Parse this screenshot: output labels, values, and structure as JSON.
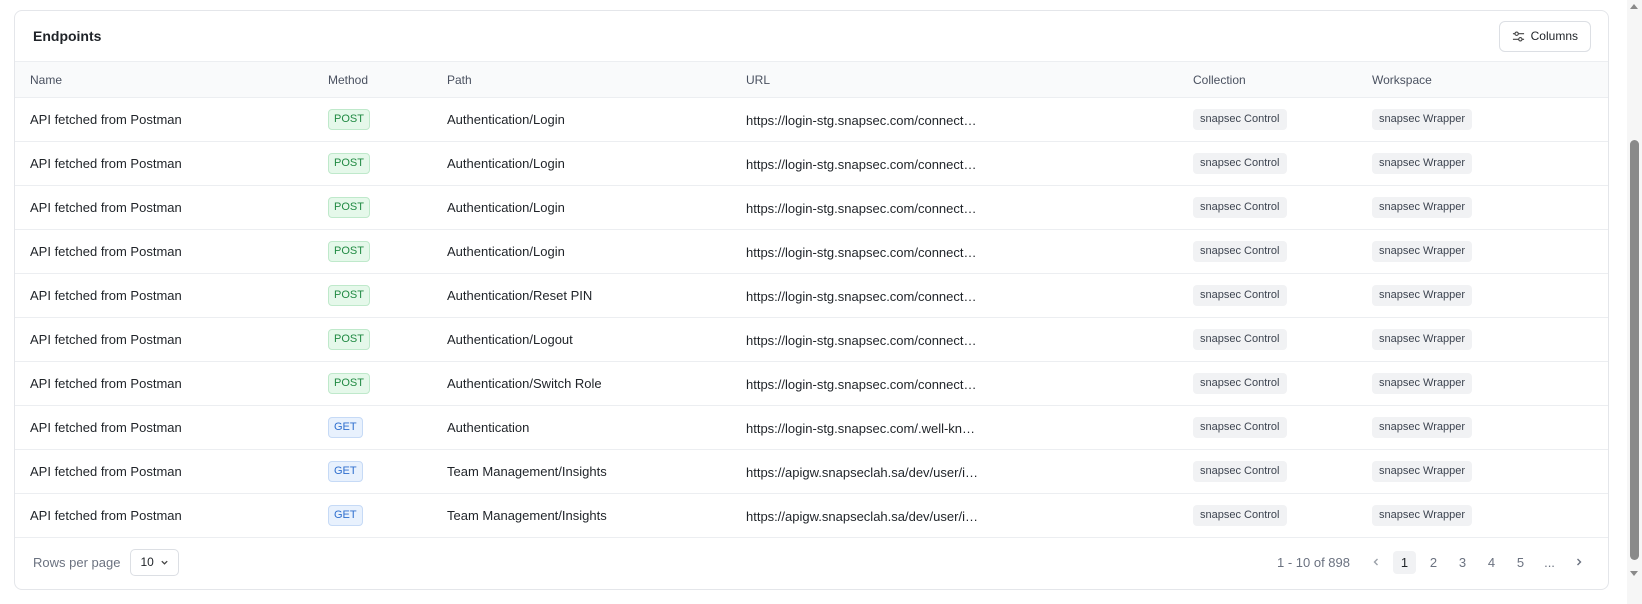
{
  "card": {
    "title": "Endpoints",
    "columns_button": "Columns"
  },
  "table": {
    "headers": [
      "Name",
      "Method",
      "Path",
      "URL",
      "Collection",
      "Workspace"
    ],
    "rows": [
      {
        "name": "API fetched from Postman",
        "method": "POST",
        "path": "Authentication/Login",
        "url": "https://login-stg.snapsec.com/connect/…",
        "collection": "snapsec Control",
        "workspace": "snapsec Wrapper"
      },
      {
        "name": "API fetched from Postman",
        "method": "POST",
        "path": "Authentication/Login",
        "url": "https://login-stg.snapsec.com/connect/…",
        "collection": "snapsec Control",
        "workspace": "snapsec Wrapper"
      },
      {
        "name": "API fetched from Postman",
        "method": "POST",
        "path": "Authentication/Login",
        "url": "https://login-stg.snapsec.com/connect/…",
        "collection": "snapsec Control",
        "workspace": "snapsec Wrapper"
      },
      {
        "name": "API fetched from Postman",
        "method": "POST",
        "path": "Authentication/Login",
        "url": "https://login-stg.snapsec.com/connect/…",
        "collection": "snapsec Control",
        "workspace": "snapsec Wrapper"
      },
      {
        "name": "API fetched from Postman",
        "method": "POST",
        "path": "Authentication/Reset PIN",
        "url": "https://login-stg.snapsec.com/connect/…",
        "collection": "snapsec Control",
        "workspace": "snapsec Wrapper"
      },
      {
        "name": "API fetched from Postman",
        "method": "POST",
        "path": "Authentication/Logout",
        "url": "https://login-stg.snapsec.com/connect/…",
        "collection": "snapsec Control",
        "workspace": "snapsec Wrapper"
      },
      {
        "name": "API fetched from Postman",
        "method": "POST",
        "path": "Authentication/Switch Role",
        "url": "https://login-stg.snapsec.com/connect/…",
        "collection": "snapsec Control",
        "workspace": "snapsec Wrapper"
      },
      {
        "name": "API fetched from Postman",
        "method": "GET",
        "path": "Authentication",
        "url": "https://login-stg.snapsec.com/.well-kn…",
        "collection": "snapsec Control",
        "workspace": "snapsec Wrapper"
      },
      {
        "name": "API fetched from Postman",
        "method": "GET",
        "path": "Team Management/Insights",
        "url": "https://apigw.snapseclah.sa/dev/user/i…",
        "collection": "snapsec Control",
        "workspace": "snapsec Wrapper"
      },
      {
        "name": "API fetched from Postman",
        "method": "GET",
        "path": "Team Management/Insights",
        "url": "https://apigw.snapseclah.sa/dev/user/i…",
        "collection": "snapsec Control",
        "workspace": "snapsec Wrapper"
      }
    ]
  },
  "footer": {
    "rows_per_page_label": "Rows per page",
    "rows_per_page_value": "10",
    "range_text": "1 - 10 of 898",
    "pages": [
      "1",
      "2",
      "3",
      "4",
      "5",
      "..."
    ],
    "active_page": "1"
  },
  "icons": {
    "columns": "sliders-icon",
    "select": "chevron-down-icon",
    "prev": "chevron-left-icon",
    "next": "chevron-right-icon"
  },
  "colors": {
    "post_bg": "#e5f8ea",
    "post_text": "#218a43",
    "get_bg": "#e8f1fd",
    "get_text": "#2f6fce"
  }
}
